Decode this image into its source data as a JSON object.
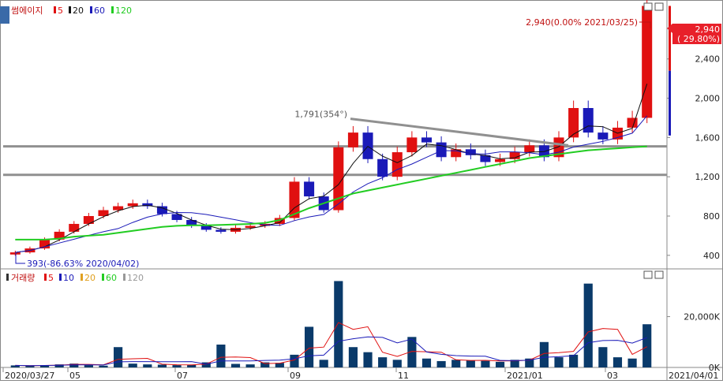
{
  "price_panel": {
    "legend": {
      "name": "썸에이지",
      "ma_labels": [
        "5",
        "20",
        "60",
        "120"
      ],
      "ma_colors": [
        "#e01010",
        "#111111",
        "#1a1ab8",
        "#22cc22"
      ]
    },
    "annotations": {
      "high": "2,940(0.00% 2021/03/25)",
      "low": "393(-86.63% 2020/04/02)",
      "trendline": "1,791(354°)"
    },
    "current_price": "2,940",
    "current_change": "( 29.80%)",
    "buttons": [
      "□",
      "□"
    ],
    "corner_icon": "settings-icon"
  },
  "volume_panel": {
    "legend": {
      "name": "거래량",
      "ma_labels": [
        "5",
        "10",
        "20",
        "60",
        "120"
      ],
      "ma_colors": [
        "#e01010",
        "#1a1ab8",
        "#e0a020",
        "#22cc22",
        "#999999"
      ]
    },
    "buttons": [
      "□",
      "□"
    ]
  },
  "x_axis_labels": [
    "2020/03/27",
    "05",
    "07",
    "09",
    "11",
    "2021/01",
    "03",
    "2021/04/01"
  ],
  "colors": {
    "up": "#e01010",
    "down": "#1a1ab8",
    "ma5": "#e01010",
    "ma20": "#111111",
    "ma60": "#1a1ab8",
    "ma120": "#22cc22",
    "hline": "#909090",
    "volume_bar": "#0a3a6a",
    "price_tag": "#e8202a"
  },
  "chart_data": [
    {
      "type": "candlestick",
      "title": "썸에이지",
      "x_start": "2020/03/27",
      "x_end": "2021/04/01",
      "y_ticks": [
        "400",
        "800",
        "1,200",
        "1,600",
        "2,000",
        "2,400"
      ],
      "ylim": [
        270,
        2960
      ],
      "closes_weekly": [
        430,
        470,
        560,
        640,
        720,
        800,
        860,
        900,
        930,
        900,
        820,
        760,
        700,
        660,
        640,
        680,
        700,
        720,
        780,
        1150,
        1000,
        860,
        1500,
        1650,
        1380,
        1200,
        1450,
        1600,
        1550,
        1400,
        1480,
        1420,
        1350,
        1380,
        1450,
        1520,
        1400,
        1600,
        1900,
        1650,
        1580,
        1700,
        1800,
        2940
      ],
      "horizontal_lines": [
        1510,
        1220
      ],
      "trendline": {
        "from": "2020/10/08",
        "to": "2021/02/05",
        "y_from": 1791,
        "y_to": 1520
      },
      "high": {
        "value": 2940,
        "change": "0.00%",
        "date": "2021/03/25"
      },
      "low": {
        "value": 393,
        "change": "-86.63%",
        "date": "2020/04/02"
      },
      "last": {
        "value": 2940,
        "change": "29.80%"
      },
      "ma120_points": [
        560,
        560,
        560,
        570,
        590,
        600,
        610,
        630,
        650,
        670,
        690,
        700,
        705,
        705,
        710,
        715,
        720,
        730,
        760,
        820,
        880,
        930,
        980,
        1030,
        1060,
        1090,
        1120,
        1150,
        1180,
        1210,
        1240,
        1270,
        1300,
        1330,
        1360,
        1390,
        1410,
        1430,
        1450,
        1470,
        1480,
        1490,
        1500,
        1510
      ]
    },
    {
      "type": "bar",
      "title": "거래량",
      "y_ticks": [
        "0K",
        "20,000K"
      ],
      "ylim": [
        0,
        36000
      ],
      "values_k": [
        800,
        600,
        900,
        1200,
        1500,
        900,
        700,
        8000,
        1500,
        1200,
        1100,
        900,
        1000,
        2000,
        9000,
        1400,
        1200,
        2000,
        1800,
        5000,
        16000,
        3000,
        34000,
        8000,
        6000,
        4000,
        3000,
        12000,
        3500,
        2500,
        3000,
        2800,
        2600,
        2200,
        3000,
        3500,
        10000,
        4000,
        5000,
        33000,
        8000,
        4000,
        3500,
        17000
      ]
    }
  ]
}
